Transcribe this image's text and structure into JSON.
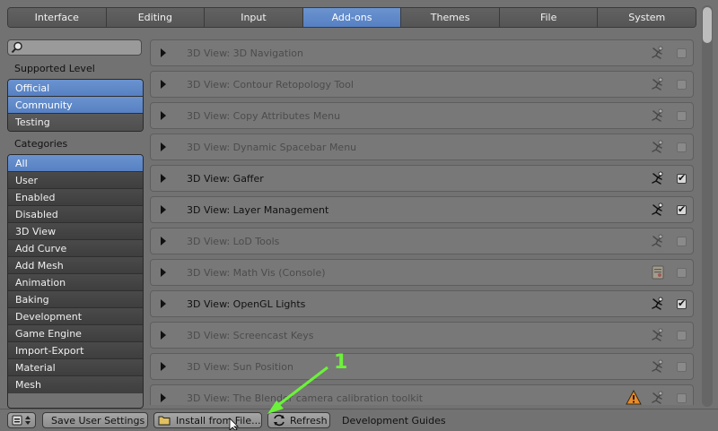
{
  "tabs": [
    "Interface",
    "Editing",
    "Input",
    "Add-ons",
    "Themes",
    "File",
    "System"
  ],
  "active_tab": "Add-ons",
  "sidebar": {
    "search_placeholder": "",
    "supported_level_label": "Supported Level",
    "supported_levels": [
      {
        "label": "Official",
        "selected": true
      },
      {
        "label": "Community",
        "selected": true
      },
      {
        "label": "Testing",
        "selected": false
      }
    ],
    "categories_label": "Categories",
    "categories": [
      {
        "label": "All",
        "selected": true
      },
      {
        "label": "User"
      },
      {
        "label": "Enabled"
      },
      {
        "label": "Disabled"
      },
      {
        "label": "3D View"
      },
      {
        "label": "Add Curve"
      },
      {
        "label": "Add Mesh"
      },
      {
        "label": "Animation"
      },
      {
        "label": "Baking"
      },
      {
        "label": "Development"
      },
      {
        "label": "Game Engine"
      },
      {
        "label": "Import-Export"
      },
      {
        "label": "Material"
      },
      {
        "label": "Mesh"
      }
    ]
  },
  "addons": [
    {
      "name": "3D View: 3D Navigation",
      "enabled": false,
      "icon": "community-icon"
    },
    {
      "name": "3D View: Contour Retopology Tool",
      "enabled": false,
      "icon": "community-icon"
    },
    {
      "name": "3D View: Copy Attributes Menu",
      "enabled": false,
      "icon": "community-icon"
    },
    {
      "name": "3D View: Dynamic Spacebar Menu",
      "enabled": false,
      "icon": "community-icon"
    },
    {
      "name": "3D View: Gaffer",
      "enabled": true,
      "icon": "community-icon"
    },
    {
      "name": "3D View: Layer Management",
      "enabled": true,
      "icon": "community-icon"
    },
    {
      "name": "3D View: LoD Tools",
      "enabled": false,
      "icon": "community-icon"
    },
    {
      "name": "3D View: Math Vis (Console)",
      "enabled": false,
      "icon": "official-icon"
    },
    {
      "name": "3D View: OpenGL Lights",
      "enabled": true,
      "icon": "community-icon"
    },
    {
      "name": "3D View: Screencast Keys",
      "enabled": false,
      "icon": "community-icon"
    },
    {
      "name": "3D View: Sun Position",
      "enabled": false,
      "icon": "community-icon"
    },
    {
      "name": "3D View: The Blender camera calibration toolkit",
      "enabled": false,
      "icon": "community-icon",
      "warning": true
    }
  ],
  "bottom": {
    "save_label": "Save User Settings",
    "install_label": "Install from File...",
    "refresh_label": "Refresh",
    "dev_guides_label": "Development Guides"
  },
  "annotation": {
    "number": "1",
    "color": "#6cf23a"
  },
  "colors": {
    "accent": "#5680c2",
    "panel": "#727272"
  }
}
